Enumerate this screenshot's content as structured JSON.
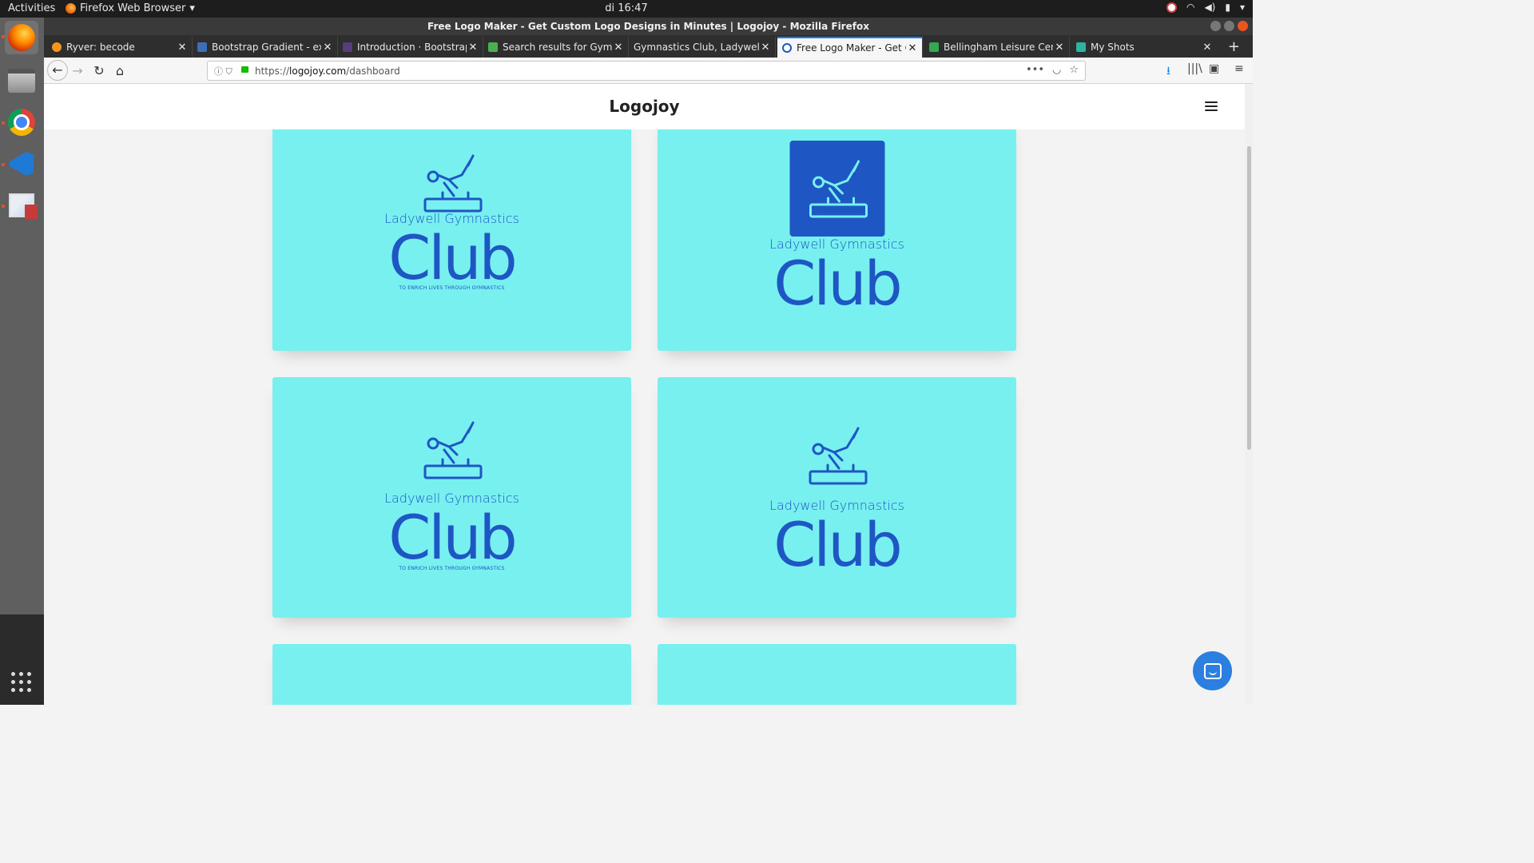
{
  "system": {
    "activities": "Activities",
    "app_menu": "Firefox Web Browser",
    "clock": "di 16:47"
  },
  "window": {
    "title": "Free Logo Maker - Get Custom Logo Designs in Minutes | Logojoy - Mozilla Firefox"
  },
  "tabs": [
    {
      "label": "Ryver: becode",
      "favicon_color": "#f7941d"
    },
    {
      "label": "Bootstrap Gradient - exa",
      "favicon_color": "#3b6fb6"
    },
    {
      "label": "Introduction · Bootstrap",
      "favicon_color": "#563d7c"
    },
    {
      "label": "Search results for Gymna",
      "favicon_color": "#4caf50"
    },
    {
      "label": "Gymnastics Club, Ladywell, ",
      "favicon_color": ""
    },
    {
      "label": "Free Logo Maker - Get Cu",
      "favicon_color": "#1e56c4"
    },
    {
      "label": "Bellingham Leisure Centr",
      "favicon_color": "#34a853"
    },
    {
      "label": "My Shots",
      "favicon_color": "#2bb3a3"
    }
  ],
  "navbar": {
    "url_prefix": "https://",
    "url_host": "logojoy.com",
    "url_path": "/dashboard"
  },
  "site": {
    "brand": "Logojoy"
  },
  "logos": [
    {
      "line1": "Ladywell Gymnastics",
      "line2": "Club",
      "tagline": "TO ENRICH LIVES THROUGH GYMNASTICS",
      "variant": "plain"
    },
    {
      "line1": "Ladywell Gymnastics",
      "line2": "Club",
      "tagline": "",
      "variant": "badge"
    },
    {
      "line1": "Ladywell Gymnastics",
      "line2": "Club",
      "tagline": "TO ENRICH LIVES THROUGH GYMNASTICS",
      "variant": "plain"
    },
    {
      "line1": "Ladywell Gymnastics",
      "line2": "Club",
      "tagline": "",
      "variant": "plain"
    }
  ],
  "colors": {
    "card_bg": "#79f0f0",
    "logo_blue": "#1e56c4",
    "firefox_accent": "#0a84ff",
    "ubuntu_orange": "#e95420"
  },
  "icons": {
    "chat": "intercom-chat-icon",
    "menu": "hamburger-menu-icon"
  }
}
